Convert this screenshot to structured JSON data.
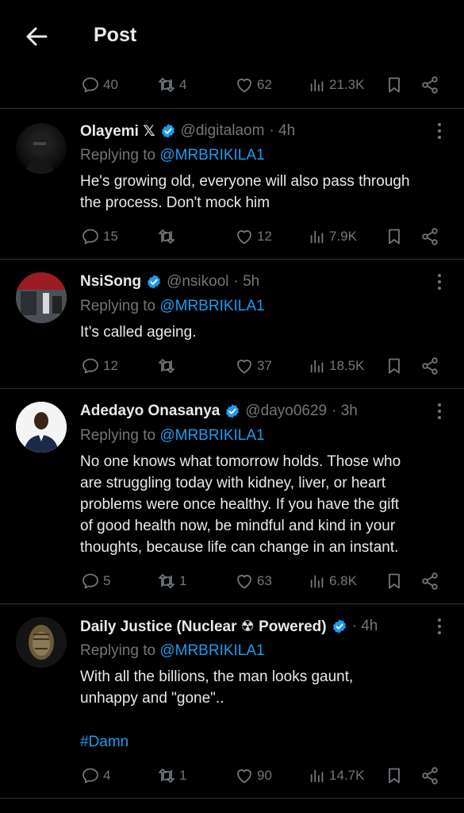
{
  "header": {
    "title": "Post"
  },
  "top_actions": {
    "replies": "40",
    "reposts": "4",
    "likes": "62",
    "views": "21.3K"
  },
  "replies": [
    {
      "name": "Olayemi 𝕏",
      "handle": "@digitalaom",
      "time": "· 4h",
      "replying_prefix": "Replying to ",
      "mention": "@MRBRIKILA1",
      "text_lines": [
        "He's growing old, everyone will also pass through",
        "the process. Don't mock him"
      ],
      "replies": "15",
      "reposts": "",
      "likes": "12",
      "views": "7.9K"
    },
    {
      "name": "NsiSong",
      "handle": "@nsikool",
      "time": "· 5h",
      "replying_prefix": "Replying to ",
      "mention": "@MRBRIKILA1",
      "text_lines": [
        "It’s called ageing."
      ],
      "replies": "12",
      "reposts": "",
      "likes": "37",
      "views": "18.5K"
    },
    {
      "name": "Adedayo Onasanya",
      "handle": "@dayo0629",
      "time": "· 3h",
      "replying_prefix": "Replying to ",
      "mention": "@MRBRIKILA1",
      "text_lines": [
        "No one knows what tomorrow holds. Those who",
        "are struggling today with kidney, liver, or heart",
        "problems were once healthy. If you have the gift",
        "of good health now, be mindful and kind in your",
        "thoughts, because life can change in an instant."
      ],
      "replies": "5",
      "reposts": "1",
      "likes": "63",
      "views": "6.8K"
    },
    {
      "name": "Daily Justice (Nuclear ☢ Powered)",
      "handle": "",
      "time": "· 4h",
      "replying_prefix": "Replying to ",
      "mention": "@MRBRIKILA1",
      "text_lines": [
        "With all the billions, the man looks gaunt,",
        "unhappy and  \"gone\".."
      ],
      "hashtag": "#Damn",
      "replies": "4",
      "reposts": "1",
      "likes": "90",
      "views": "14.7K"
    }
  ],
  "colors": {
    "background": "#000000",
    "text": "#e7e9ea",
    "muted": "#71767b",
    "accent": "#1d9bf0",
    "divider": "#2f3336"
  }
}
